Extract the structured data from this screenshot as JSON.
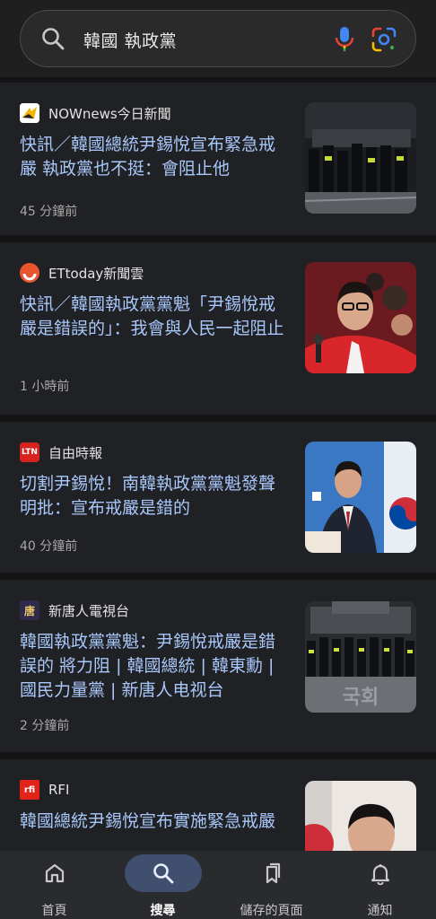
{
  "search": {
    "query": "韓國 執政黨"
  },
  "articles": [
    {
      "source": "NOWnews今日新聞",
      "headline": "快訊／韓國總統尹錫悅宣布緊急戒嚴 執政黨也不挺：會阻止他",
      "time": "45 分鐘前",
      "thumb": "riot-police-night"
    },
    {
      "source": "ETtoday新聞雲",
      "headline": "快訊／韓國執政黨黨魁「尹錫悅戒嚴是錯誤的」：我會與人民一起阻止",
      "time": "1 小時前",
      "thumb": "politician-red-jacket"
    },
    {
      "source": "自由時報",
      "source_icon_text": "LTN",
      "headline": "切割尹錫悅！南韓執政黨黨魁發聲明批：宣布戒嚴是錯的",
      "time": "40 分鐘前",
      "thumb": "speaker-podium-flag"
    },
    {
      "source": "新唐人電視台",
      "source_icon_text": "唐",
      "headline": "韓國執政黨黨魁：尹錫悅戒嚴是錯誤的 將力阻 | 韓國總統 | 韓東勳 | 國民力量黨 | 新唐人电视台",
      "time": "2 分鐘前",
      "thumb": "police-line-building"
    },
    {
      "source": "RFI",
      "source_icon_text": "rfi",
      "headline": "韓國總統尹錫悅宣布實施緊急戒嚴",
      "time": "",
      "thumb": "president-portrait"
    }
  ],
  "nav": [
    {
      "label": "首頁",
      "icon": "home-icon",
      "active": false
    },
    {
      "label": "搜尋",
      "icon": "search-icon",
      "active": true
    },
    {
      "label": "儲存的頁面",
      "icon": "bookmarks-icon",
      "active": false
    },
    {
      "label": "通知",
      "icon": "bell-icon",
      "active": false
    }
  ]
}
